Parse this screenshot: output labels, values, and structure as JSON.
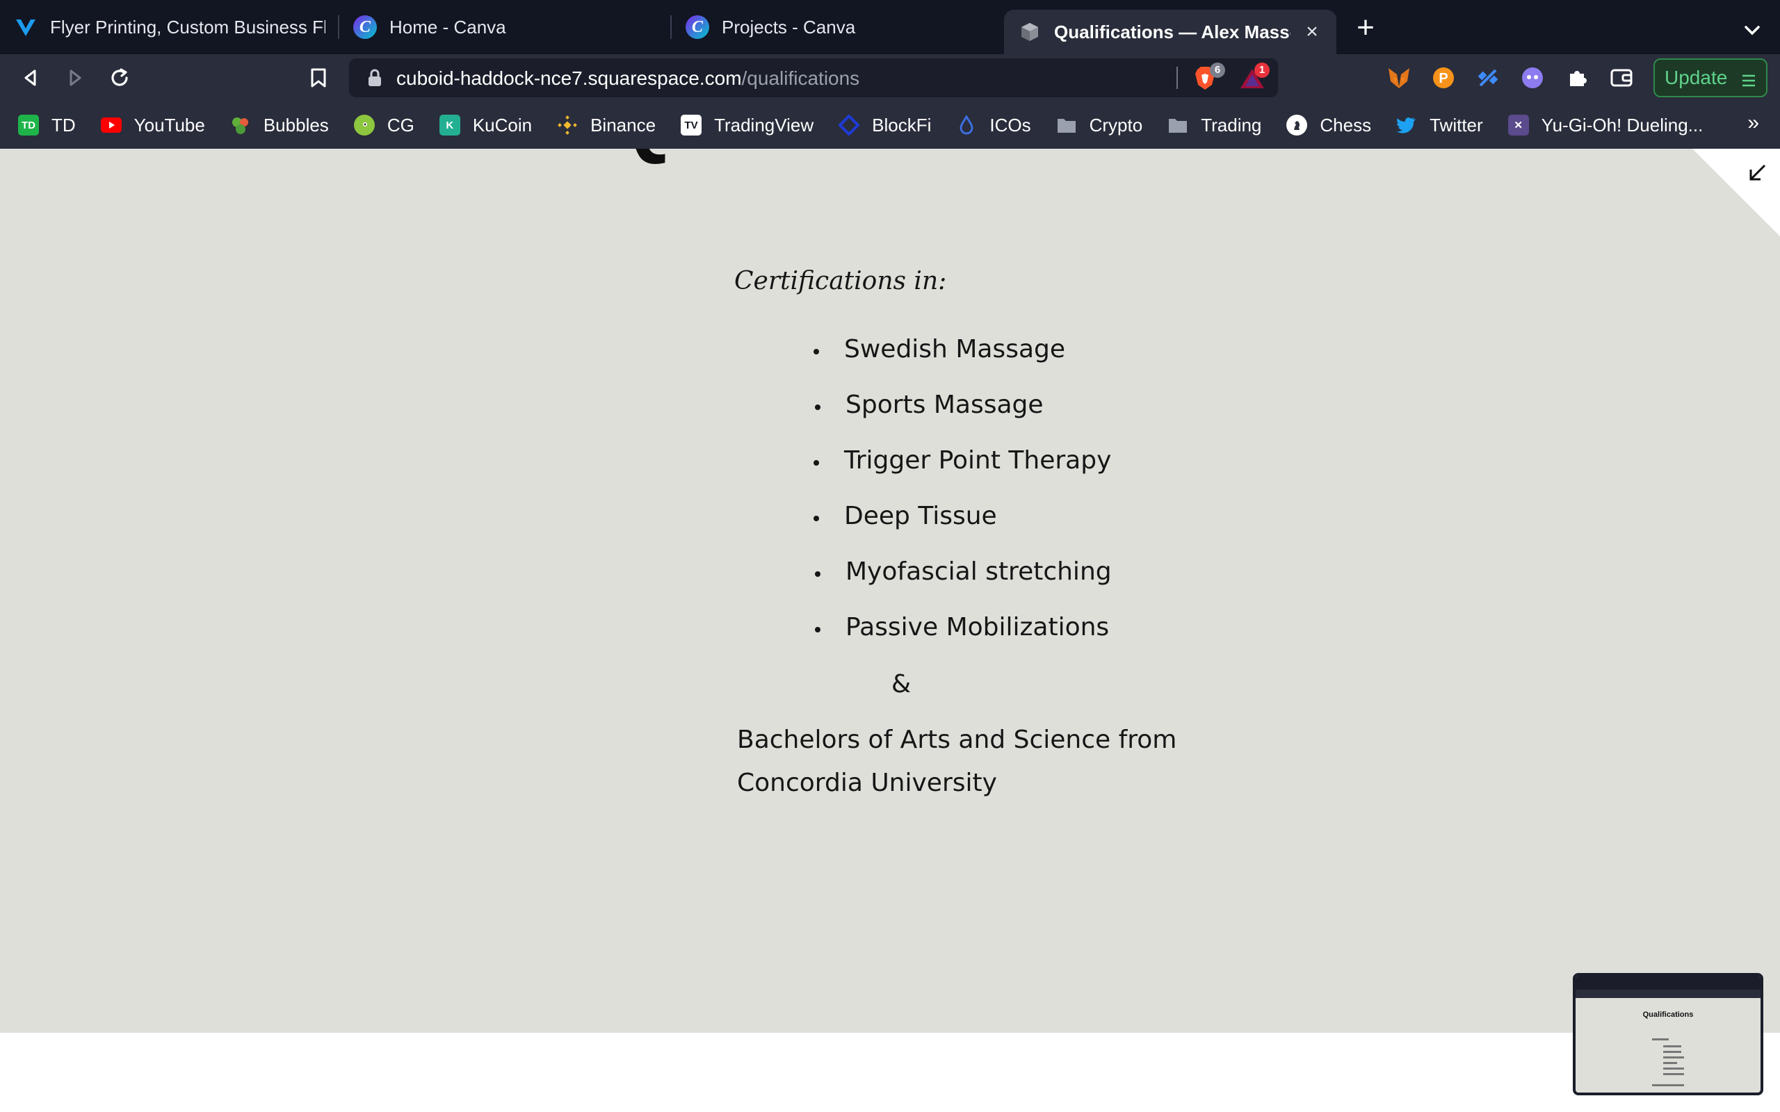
{
  "tabs": [
    {
      "title": "Flyer Printing, Custom Business Flye",
      "favicon": "vistaprint-icon",
      "color": "#1c9bf0"
    },
    {
      "title": "Home - Canva",
      "favicon": "canva-icon",
      "color": "#2fb8e6"
    },
    {
      "title": "Projects - Canva",
      "favicon": "canva-icon",
      "color": "#2fb8e6"
    },
    {
      "title": "Qualifications — Alex Massothe",
      "favicon": "squarespace-cube-icon",
      "active": true
    }
  ],
  "toolbar": {
    "url_host": "cuboid-haddock-nce7.squarespace.com",
    "url_path": "/qualifications",
    "brave_shields_count": "6",
    "brave_rewards_count": "1",
    "update_label": "Update"
  },
  "bookmarks": [
    {
      "label": "TD",
      "icon": "td-icon",
      "color": "#1eb44a"
    },
    {
      "label": "YouTube",
      "icon": "youtube-icon",
      "color": "#ff0000"
    },
    {
      "label": "Bubbles",
      "icon": "bubbles-icon",
      "color": "#5fae3a"
    },
    {
      "label": "CG",
      "icon": "coingecko-icon",
      "color": "#8dc63f"
    },
    {
      "label": "KuCoin",
      "icon": "kucoin-icon",
      "color": "#23af91"
    },
    {
      "label": "Binance",
      "icon": "binance-icon",
      "color": "#f3ba2f"
    },
    {
      "label": "TradingView",
      "icon": "tradingview-icon",
      "color": "#131722"
    },
    {
      "label": "BlockFi",
      "icon": "blockfi-icon",
      "color": "#1f3bd6"
    },
    {
      "label": "ICOs",
      "icon": "drop-icon",
      "color": "#3b6fe0"
    },
    {
      "label": "Crypto",
      "icon": "folder-icon",
      "color": "#9aa0ae"
    },
    {
      "label": "Trading",
      "icon": "folder-icon",
      "color": "#9aa0ae"
    },
    {
      "label": "Chess",
      "icon": "chess-icon",
      "color": "#ffffff"
    },
    {
      "label": "Twitter",
      "icon": "twitter-icon",
      "color": "#1da1f2"
    },
    {
      "label": "Yu-Gi-Oh! Dueling...",
      "icon": "yugioh-icon",
      "color": "#5b4a8c"
    }
  ],
  "page": {
    "title": "Qualifications",
    "certifications_heading": "Certifications in:",
    "certifications": [
      "Swedish Massage",
      "Sports Massage",
      "Trigger Point Therapy",
      "Deep Tissue",
      "Myofascial stretching",
      "Passive Mobilizations"
    ],
    "ampersand": "&",
    "degree_line_1": "Bachelors of Arts and Science from",
    "degree_line_2": "Concordia University",
    "background_color": "#dfdfda"
  },
  "thumbnail": {
    "title": "Qualifications"
  }
}
